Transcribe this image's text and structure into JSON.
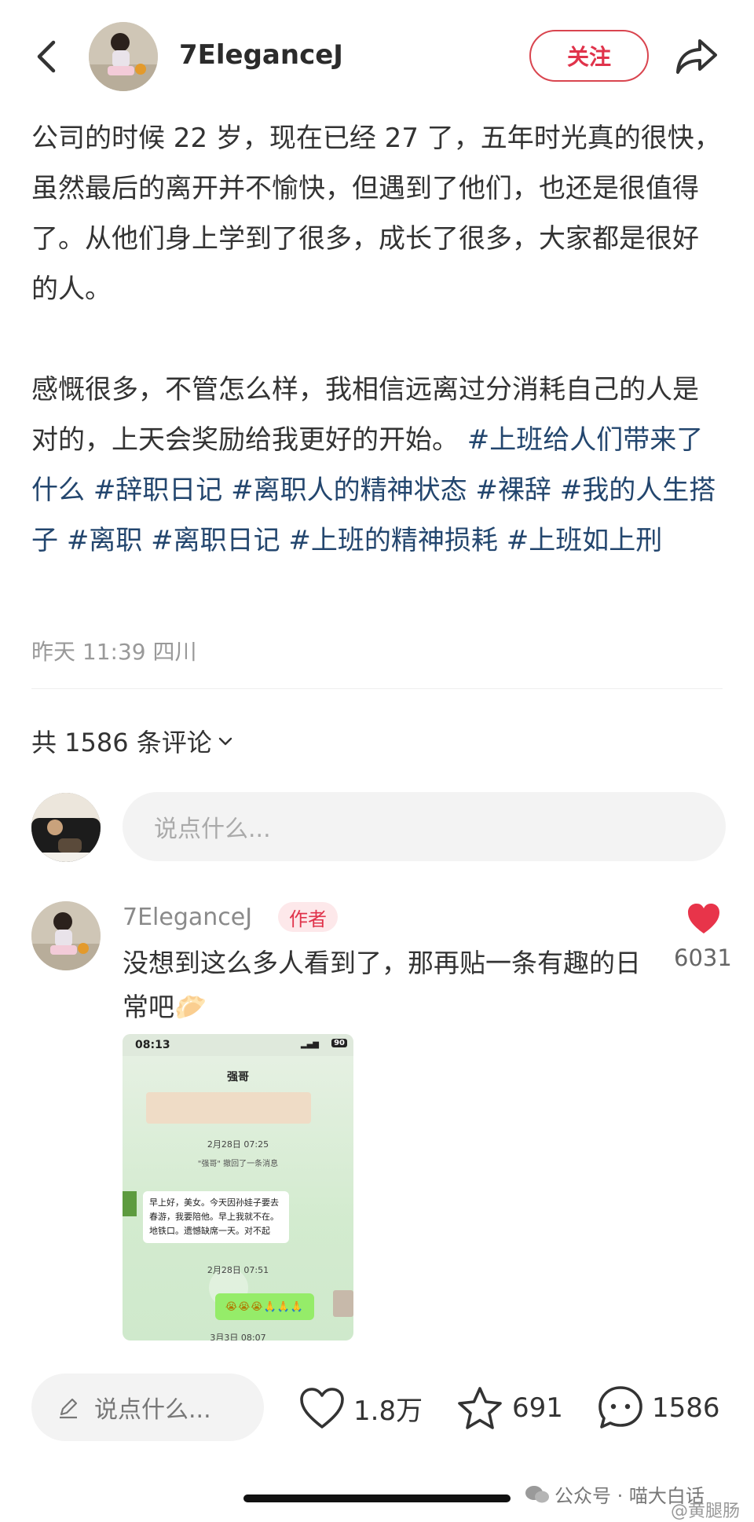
{
  "header": {
    "username": "7EleganceJ",
    "follow_label": "关注"
  },
  "post": {
    "para1": "公司的时候 22 岁，现在已经 27 了，五年时光真的很快，虽然最后的离开并不愉快，但遇到了他们，也还是很值得了。从他们身上学到了很多，成长了很多，大家都是很好的人。",
    "para2_text": "感慨很多，不管怎么样，我相信远离过分消耗自己的人是对的，上天会奖励给我更好的开始。",
    "hashtags": [
      "#上班给人们带来了什么",
      "#辞职日记",
      "#离职人的精神状态",
      "#裸辞",
      "#我的人生搭子",
      "#离职",
      "#离职日记",
      "#上班的精神损耗",
      "#上班如上刑"
    ],
    "meta": "昨天 11:39 四川"
  },
  "comments_header": {
    "count_label": "共 1586 条评论"
  },
  "comment_input": {
    "placeholder": "说点什么..."
  },
  "comment": {
    "name": "7EleganceJ",
    "badge": "作者",
    "text": "没想到这么多人看到了，那再贴一条有趣的日常吧",
    "emoji": "🥟",
    "likes": "6031",
    "image": {
      "time": "08:13",
      "battery": "90",
      "chat_title": "强哥",
      "ts1": "2月28日 07:25",
      "sys_msg": "\"强哥\" 撤回了一条消息",
      "msg": "早上好，美女。今天因孙娃子要去春游，我要陪他。早上我就不在。地铁口。遗憾缺席一天。对不起",
      "ts2": "2月28日 07:51",
      "bubble": "😭😭😭🙏🙏🙏",
      "ts3": "3月3日 08:07"
    }
  },
  "bottom_bar": {
    "input_placeholder": "说点什么...",
    "likes": "1.8万",
    "favorites": "691",
    "comments": "1586"
  },
  "watermark": {
    "text": "公众号 · 喵大白话",
    "sub": "@黄腿肠"
  },
  "colors": {
    "accent_red": "#e0334b",
    "hashtag_blue": "#23466e"
  }
}
